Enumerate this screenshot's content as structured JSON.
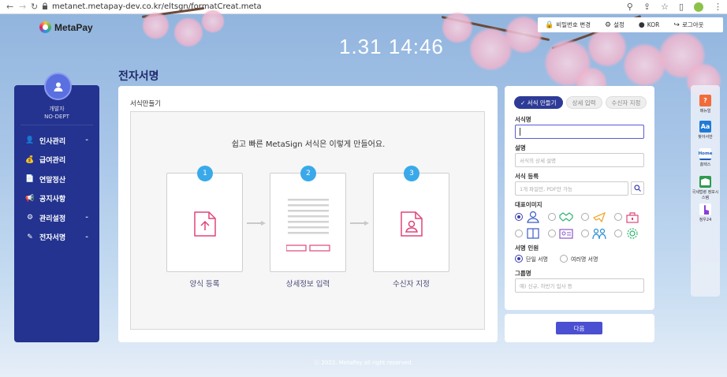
{
  "browser": {
    "url": "metanet.metapay-dev.co.kr/eltsgn/formatCreat.meta"
  },
  "header": {
    "logo_text": "MetaPay",
    "clock": "1.31  14:46",
    "topbar": {
      "password_change": "비밀번호 변경",
      "settings": "설정",
      "language": "KOR",
      "logout": "로그아웃"
    }
  },
  "page_title": "전자서명",
  "sidebar": {
    "user_name": "개발자",
    "user_dept": "NO-DEPT",
    "items": [
      {
        "label": "인사관리",
        "icon": "person-icon",
        "caret": "-"
      },
      {
        "label": "급여관리",
        "icon": "money-bag-icon",
        "caret": ""
      },
      {
        "label": "연말정산",
        "icon": "document-coin-icon",
        "caret": ""
      },
      {
        "label": "공지사항",
        "icon": "megaphone-icon",
        "caret": ""
      },
      {
        "label": "관리설정",
        "icon": "gear-icon",
        "caret": "-"
      },
      {
        "label": "전자서명",
        "icon": "pen-icon",
        "caret": "-"
      }
    ]
  },
  "main": {
    "section_label": "서식만들기",
    "headline": "쉽고 빠른 MetaSign 서식은 이렇게 만들어요.",
    "steps": [
      {
        "num": "1",
        "label": "양식 등록"
      },
      {
        "num": "2",
        "label": "상세정보 입력"
      },
      {
        "num": "3",
        "label": "수신자 지정"
      }
    ]
  },
  "form": {
    "tabs": [
      "✓ 서식 만들기",
      "상세 입력",
      "수신자 지정"
    ],
    "name_label": "서식명",
    "desc_label": "설명",
    "desc_placeholder": "서식의 상세 설명",
    "register_label": "서식 등록",
    "register_placeholder": "1개 파일만, PDF만 가능",
    "image_label": "대표이미지",
    "signer_label": "서명 인원",
    "signer_options": [
      "단일 서명",
      "여러명 서명"
    ],
    "group_label": "그룹명",
    "group_placeholder": "예) 신규, 하반기 입사 등",
    "next": "다음"
  },
  "quick": [
    {
      "label": "매뉴얼",
      "color": "#f26b3a",
      "glyph": "?"
    },
    {
      "label": "찾아서만",
      "color": "#1f7bd6",
      "glyph": "Aa"
    },
    {
      "label": "홈택스",
      "color": "#ffffff",
      "glyph": "Home"
    },
    {
      "label": "국세법령 정보시스템",
      "color": "#2e9b4f",
      "glyph": ""
    },
    {
      "label": "정우24",
      "color": "#ffffff",
      "glyph": ""
    }
  ],
  "footer": "ⓒ 2022. MetaPay all right reserved.",
  "colors": {
    "sidebar": "#23338f",
    "accent": "#3aa9ea",
    "primary_button": "#4b4fd1",
    "step_icon": "#e0457b"
  }
}
